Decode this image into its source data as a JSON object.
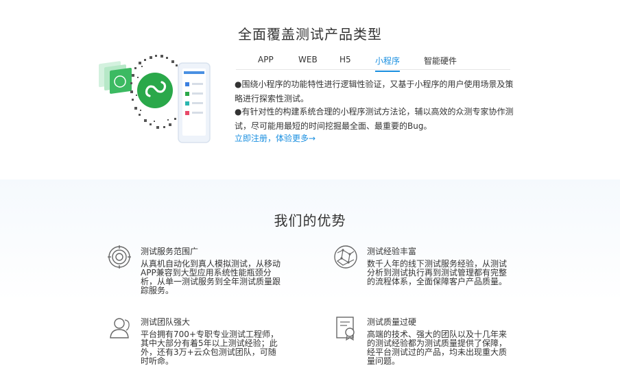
{
  "product_types": {
    "title": "全面覆盖测试产品类型",
    "tabs": [
      "APP",
      "WEB",
      "H5",
      "小程序",
      "智能硬件"
    ],
    "active_tab": "小程序",
    "description_1": "●围绕小程序的功能特性进行逻辑性验证，又基于小程序的用户使用场景及策略进行探索性测试。",
    "description_2": "●有针对性的构建系统合理的小程序测试方法论，辅以高效的众测专家协作测试，尽可能用最短的时间挖掘最全面、最重要的Bug。",
    "cta": "立即注册，体验更多→"
  },
  "advantages": {
    "title": "我们的优势",
    "items": [
      {
        "icon": "target-rings-icon",
        "title": "测试服务范围广",
        "desc": "从真机自动化到真人模拟测试，从移动APP兼容到大型应用系统性能瓶颈分析，从单一测试服务到全年测试质量跟踪服务。"
      },
      {
        "icon": "network-globe-icon",
        "title": "测试经验丰富",
        "desc": "数千人年的线下测试服务经验，从测试分析到测试执行再到测试管理都有完整的流程体系，全面保障客户产品质量。"
      },
      {
        "icon": "team-people-icon",
        "title": "测试团队强大",
        "desc": "平台拥有700+专职专业测试工程师，其中大部分有着5年以上测试经验；此外，还有3万+云众包测试团队，可随时听命。"
      },
      {
        "icon": "certificate-icon",
        "title": "测试质量过硬",
        "desc": "高端的技术、强大的团队以及十几年来的测试经验都为测试质量提供了保障，经平台测试过的产品，均未出现重大质量问题。"
      }
    ]
  },
  "colors": {
    "accent": "#1a8fe0",
    "text": "#333333",
    "miniprogram_green": "#2aa84a"
  }
}
